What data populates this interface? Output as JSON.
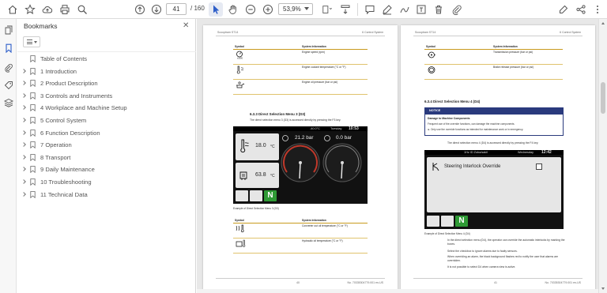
{
  "toolbar": {
    "current_page": "41",
    "page_total": "/ 160",
    "zoom": "53,9%"
  },
  "bookmarks": {
    "title": "Bookmarks",
    "items": [
      {
        "label": "Table of Contents",
        "expandable": false
      },
      {
        "label": "1 Introduction",
        "expandable": true
      },
      {
        "label": "2 Product Description",
        "expandable": true
      },
      {
        "label": "3 Controls and Instruments",
        "expandable": true
      },
      {
        "label": "4 Workplace and Machine Setup",
        "expandable": true
      },
      {
        "label": "5 Control System",
        "expandable": true
      },
      {
        "label": "6 Function Description",
        "expandable": true
      },
      {
        "label": "7 Operation",
        "expandable": true
      },
      {
        "label": "8 Transport",
        "expandable": true
      },
      {
        "label": "9 Daily Maintenance",
        "expandable": true
      },
      {
        "label": "10 Troubleshooting",
        "expandable": true
      },
      {
        "label": "11 Technical Data",
        "expandable": true
      }
    ]
  },
  "page_left": {
    "header_left": "Scooptram ST14",
    "header_right": "6 Control System",
    "table1": {
      "col_symbol": "Symbol",
      "col_info": "System Information",
      "rows": [
        "Engine speed (rpm)",
        "Engine coolant temperature (°C or °F)",
        "Engine oil pressure (bar or psi)"
      ]
    },
    "section": "6.3.3 Direct Selection Menu 3 (D3)",
    "intro": "The direct selection menu 3 (D3) is accessed directly by pressing the F3 key.",
    "screen": {
      "temp_top": "-40.0°C",
      "time_label": "Tuesday",
      "time": "10:53",
      "coolant_value": "18.0",
      "coolant_unit": "°C",
      "oil_value": "63.8",
      "oil_unit": "°C",
      "pressure1": "21.2 bar",
      "pressure2": "0.0 bar",
      "n_label": "N"
    },
    "caption": "Example of Direct Selection Menu 3 (D3)",
    "table2": {
      "col_symbol": "Symbol",
      "col_info": "System Information",
      "rows": [
        "Converter out oil temperature (°C or °F)",
        "Hydraulic oil temperature (°C or °F)"
      ]
    },
    "footer_page": "40",
    "footer_doc": "No. 70335304779.001 en-US"
  },
  "page_right": {
    "header_left": "Scooptram ST14",
    "header_right": "6 Control System",
    "table1": {
      "col_symbol": "Symbol",
      "col_info": "System Information",
      "rows": [
        "Transmission pressure (bar or psi)",
        "Brake release pressure (bar or psi)"
      ]
    },
    "section": "6.3.4 Direct Selection Menu 4 (D4)",
    "notice": {
      "title": "NOTICE",
      "heading": "Damage to Machine Components",
      "line1": "Frequent use of the override functions, can damage the machine components.",
      "line2": "Only use the override functions as intended for maintenance work or in emergency."
    },
    "intro": "The direct selection menu 4 (D4) is accessed directly by pressing the F4 key.",
    "screen": {
      "top_left": "1Hz ID Zoba/sakil",
      "day": "Wednesday",
      "time": "12:42",
      "override_label": "Steering Interlock Override",
      "n_label": "N"
    },
    "caption": "Example of Direct Selection Menu 4 (D4)",
    "para1": "In the direct selection menu (D4), the operator can override the automatic interlocks by marking the boxes.",
    "para2": "Select the checkbox to ignore alarms due to faulty sensors.",
    "para3": "When overriding an alarm, the black background flashes red to notify the user that alarms are overridden.",
    "para4": "It is not possible to select D4 when camera view is active.",
    "footer_page": "41",
    "footer_doc": "No. 70335304779.001 en-US"
  },
  "colors": {
    "accent_blue": "#2a3a7d",
    "table_rule": "#c99a1e",
    "green_n": "#2f9a35"
  }
}
